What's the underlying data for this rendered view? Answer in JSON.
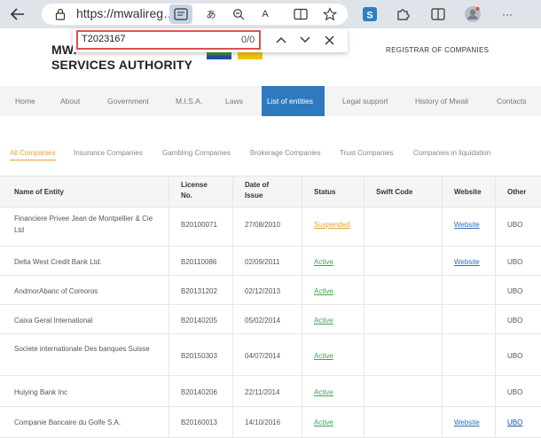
{
  "browser": {
    "url": "https://mwalireg…",
    "icons": [
      "back-arrow-icon",
      "lock-icon",
      "reader-mode-icon",
      "translate-icon",
      "zoom-icon",
      "read-aloud-icon",
      "immersive-reader-icon",
      "favorite-star-icon",
      "s-extension-icon",
      "extensions-icon",
      "split-screen-icon",
      "profile-icon",
      "more-icon"
    ]
  },
  "findbar": {
    "query": "T2023167",
    "count": "0/0"
  },
  "site": {
    "logo_line1": "MW.",
    "logo_line2": "SERVICES AUTHORITY",
    "registrar": "REGISTRAR OF COMPANIES"
  },
  "nav": {
    "items": [
      "Home",
      "About",
      "Government",
      "M.I.S.A.",
      "Laws",
      "List of entities",
      "Legal support",
      "History of Mwali",
      "Contacts"
    ],
    "active": "List of entities",
    "active_color": "#2e7abf"
  },
  "categories": {
    "items": [
      "All Companies",
      "Insurance Companies",
      "Gambling Companies",
      "Brokerage Companies",
      "Trust Companies",
      "Companies in liquidation"
    ],
    "active": "All Companies"
  },
  "table": {
    "headers": [
      "Name of Entity",
      "License No.",
      "Date of Issue",
      "Status",
      "Swift Code",
      "Website",
      "Other"
    ],
    "rows": [
      {
        "name": "Financiere Privee Jean de Montpellier & Cie Ltd",
        "license": "B20100071",
        "date": "27/08/2010",
        "status": "Suspended",
        "swift": "",
        "website": "Website",
        "other": "UBO"
      },
      {
        "name": "Delta West Credit Bank Ltd.",
        "license": "B20110086",
        "date": "02/09/2011",
        "status": "Active",
        "swift": "",
        "website": "Website",
        "other": "UBO"
      },
      {
        "name": "AndmorAbanc of Comoros",
        "license": "B20131202",
        "date": "02/12/2013",
        "status": "Active",
        "swift": "",
        "website": "",
        "other": "UBO"
      },
      {
        "name": "Caixa Geral International",
        "license": "B20140205",
        "date": "05/02/2014",
        "status": "Active",
        "swift": "",
        "website": "",
        "other": "UBO"
      },
      {
        "name": "Societe internationale Des banques Suisse",
        "license": "B20150303",
        "date": "04/07/2014",
        "status": "Active",
        "swift": "",
        "website": "",
        "other": "UBO"
      },
      {
        "name": "Huiying Bank Inc",
        "license": "B20140206",
        "date": "22/11/2014",
        "status": "Active",
        "swift": "",
        "website": "",
        "other": "UBO"
      },
      {
        "name": "Companie Bancaire du Golfe S.A.",
        "license": "B20160013",
        "date": "14/10/2016",
        "status": "Active",
        "swift": "",
        "website": "Website",
        "other": "UBO"
      }
    ]
  },
  "colors": {
    "active_status": "#3aa54f",
    "suspended_status": "#e6a23c",
    "link": "#2e6fb8",
    "find_border": "#d9534f"
  }
}
